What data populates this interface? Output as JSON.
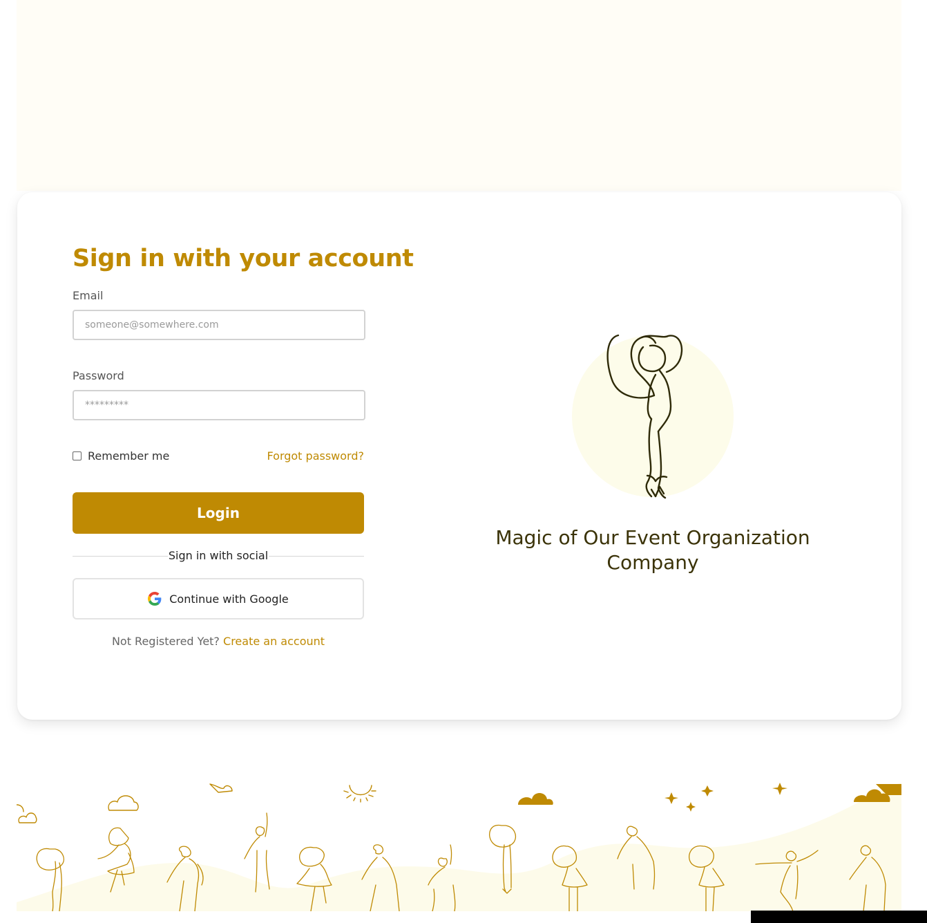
{
  "colors": {
    "accent": "#bf8a03",
    "background_band": "#fffdf6",
    "hero_circle": "#fdfcea",
    "hero_title": "#3b3308"
  },
  "login": {
    "title": "Sign in with your account",
    "email_label": "Email",
    "email_placeholder": "someone@somewhere.com",
    "password_label": "Password",
    "password_placeholder": "*********",
    "remember_label": "Remember me",
    "remember_checked": false,
    "forgot_link": "Forgot password?",
    "login_button": "Login",
    "social_divider": "Sign in with social",
    "google_button": "Continue with Google",
    "google_icon": "google-g-icon",
    "register_prompt": "Not Registered Yet?",
    "register_link": "Create an account"
  },
  "hero": {
    "title": "Magic of Our Event Organization Company",
    "illustration": "dancer-illustration"
  },
  "footer": {
    "illustration": "dancing-people-illustration"
  }
}
